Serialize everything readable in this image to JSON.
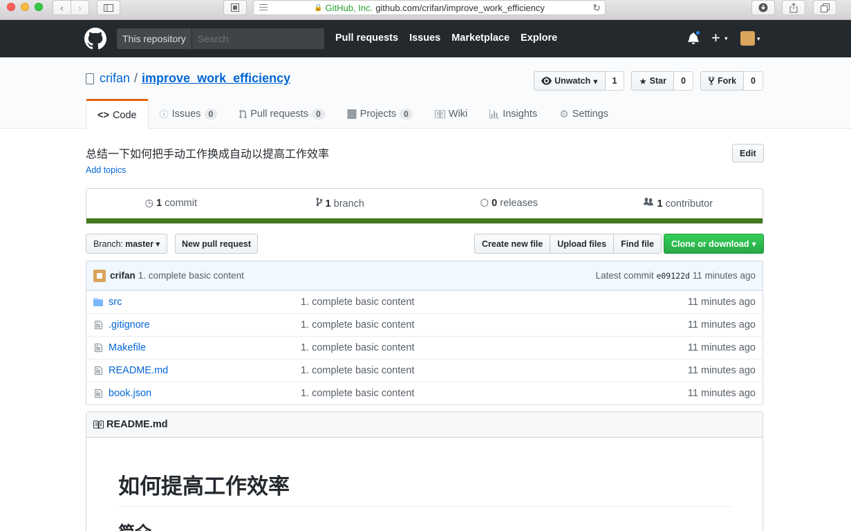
{
  "browser": {
    "address_company": "GitHub, Inc.",
    "address_url": "github.com/crifan/improve_work_efficiency"
  },
  "header": {
    "scope_label": "This repository",
    "search_placeholder": "Search",
    "nav": [
      "Pull requests",
      "Issues",
      "Marketplace",
      "Explore"
    ],
    "plus": "+"
  },
  "repo": {
    "owner": "crifan",
    "slash": "/",
    "name": "improve_work_efficiency",
    "watch_label": "Unwatch",
    "watch_count": "1",
    "star_label": "Star",
    "star_count": "0",
    "fork_label": "Fork",
    "fork_count": "0"
  },
  "tabs": [
    {
      "label": "Code",
      "counter": ""
    },
    {
      "label": "Issues",
      "counter": "0"
    },
    {
      "label": "Pull requests",
      "counter": "0"
    },
    {
      "label": "Projects",
      "counter": "0"
    },
    {
      "label": "Wiki",
      "counter": ""
    },
    {
      "label": "Insights",
      "counter": ""
    },
    {
      "label": "Settings",
      "counter": ""
    }
  ],
  "meta": {
    "description": "总结一下如何把手动工作换成自动以提高工作效率",
    "add_topics": "Add topics",
    "edit": "Edit"
  },
  "summary": {
    "commits_num": "1",
    "commits_label": "commit",
    "branches_num": "1",
    "branches_label": "branch",
    "releases_num": "0",
    "releases_label": "releases",
    "contributors_num": "1",
    "contributors_label": "contributor",
    "language_color": "#427819"
  },
  "filenav": {
    "branch_prefix": "Branch:",
    "branch_name": "master",
    "new_pr": "New pull request",
    "create_file": "Create new file",
    "upload_files": "Upload files",
    "find_file": "Find file",
    "clone": "Clone or download"
  },
  "commit_tease": {
    "author": "crifan",
    "message": "1. complete basic content",
    "latest_prefix": "Latest commit",
    "sha": "e09122d",
    "age": "11 minutes ago"
  },
  "files": [
    {
      "icon": "folder-icon",
      "name": "src",
      "message": "1. complete basic content",
      "age": "11 minutes ago"
    },
    {
      "icon": "file-icon",
      "name": ".gitignore",
      "message": "1. complete basic content",
      "age": "11 minutes ago"
    },
    {
      "icon": "file-icon",
      "name": "Makefile",
      "message": "1. complete basic content",
      "age": "11 minutes ago"
    },
    {
      "icon": "file-icon",
      "name": "README.md",
      "message": "1. complete basic content",
      "age": "11 minutes ago"
    },
    {
      "icon": "file-icon",
      "name": "book.json",
      "message": "1. complete basic content",
      "age": "11 minutes ago"
    }
  ],
  "readme": {
    "filename": "README.md",
    "h1": "如何提高工作效率",
    "h2": "简介"
  }
}
